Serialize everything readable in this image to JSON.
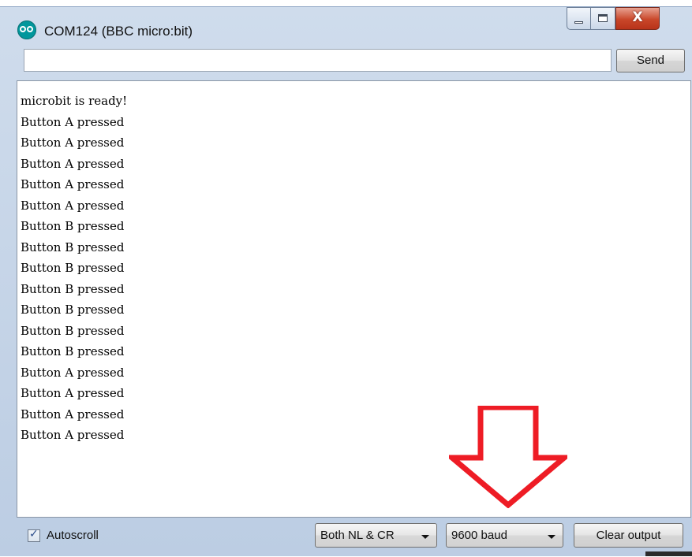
{
  "window": {
    "title": "COM124 (BBC micro:bit)",
    "icon": "arduino-icon",
    "controls": {
      "minimize_icon": "minimize-icon",
      "maximize_icon": "maximize-icon",
      "close_icon": "close-icon",
      "close_glyph": "X"
    }
  },
  "send_bar": {
    "input_value": "",
    "send_label": "Send"
  },
  "output": {
    "lines": [
      "microbit is ready!",
      "Button A pressed",
      "Button A pressed",
      "Button A pressed",
      "Button A pressed",
      "Button A pressed",
      "Button B pressed",
      "Button B pressed",
      "Button B pressed",
      "Button B pressed",
      "Button B pressed",
      "Button B pressed",
      "Button B pressed",
      "Button A pressed",
      "Button A pressed",
      "Button A pressed",
      "Button A pressed"
    ]
  },
  "annotation": {
    "icon": "red-down-arrow",
    "color": "#ee1c25"
  },
  "bottom_bar": {
    "autoscroll_label": "Autoscroll",
    "autoscroll_checked": true,
    "line_ending_value": "Both NL & CR",
    "baud_value": "9600 baud",
    "clear_label": "Clear output"
  },
  "colors": {
    "title_gradient": "#cfdcec",
    "close_button": "#c9472a",
    "app_icon": "#00979c"
  }
}
